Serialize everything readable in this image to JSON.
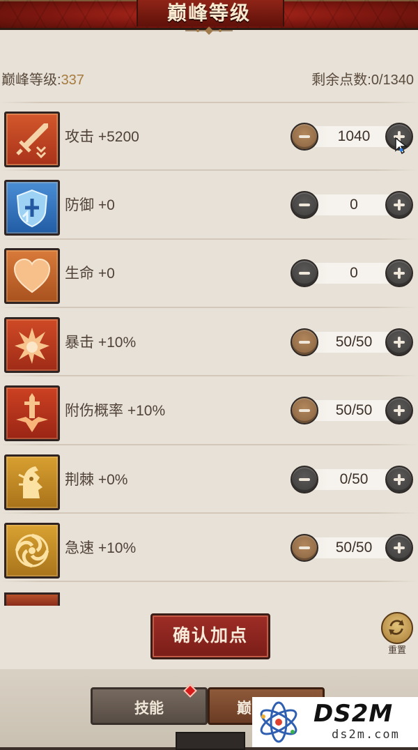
{
  "header": {
    "title": "巅峰等级"
  },
  "summary": {
    "level_label": "巅峰等级:",
    "level_value": "337",
    "points_label": "剩余点数:0/1340"
  },
  "attributes": [
    {
      "label": "攻击 +5200",
      "value": "1040",
      "icon": "sword-icon",
      "minus_active": true,
      "plus_active": false,
      "color": "#c0451f"
    },
    {
      "label": "防御 +0",
      "value": "0",
      "icon": "shield-icon",
      "minus_active": false,
      "plus_active": false,
      "color": "#2d6fb8"
    },
    {
      "label": "生命 +0",
      "value": "0",
      "icon": "heart-icon",
      "minus_active": false,
      "plus_active": false,
      "color": "#c0602a"
    },
    {
      "label": "暴击 +10%",
      "value": "50/50",
      "icon": "explosion-icon",
      "minus_active": true,
      "plus_active": false,
      "color": "#b83a21"
    },
    {
      "label": "附伤概率 +10%",
      "value": "50/50",
      "icon": "dagger-burst-icon",
      "minus_active": true,
      "plus_active": false,
      "color": "#b8371f"
    },
    {
      "label": "荆棘 +0%",
      "value": "0/50",
      "icon": "thorn-creature-icon",
      "minus_active": false,
      "plus_active": false,
      "color": "#c58c1e"
    },
    {
      "label": "急速 +10%",
      "value": "50/50",
      "icon": "swirl-icon",
      "minus_active": true,
      "plus_active": false,
      "color": "#c58c1e"
    }
  ],
  "actions": {
    "confirm_label": "确认加点",
    "reset_label": "重置"
  },
  "tabs": {
    "skills_label": "技能",
    "peak_label": "巅峰等级"
  },
  "watermark": {
    "brand": "DS2M",
    "site": "ds2m.com"
  }
}
